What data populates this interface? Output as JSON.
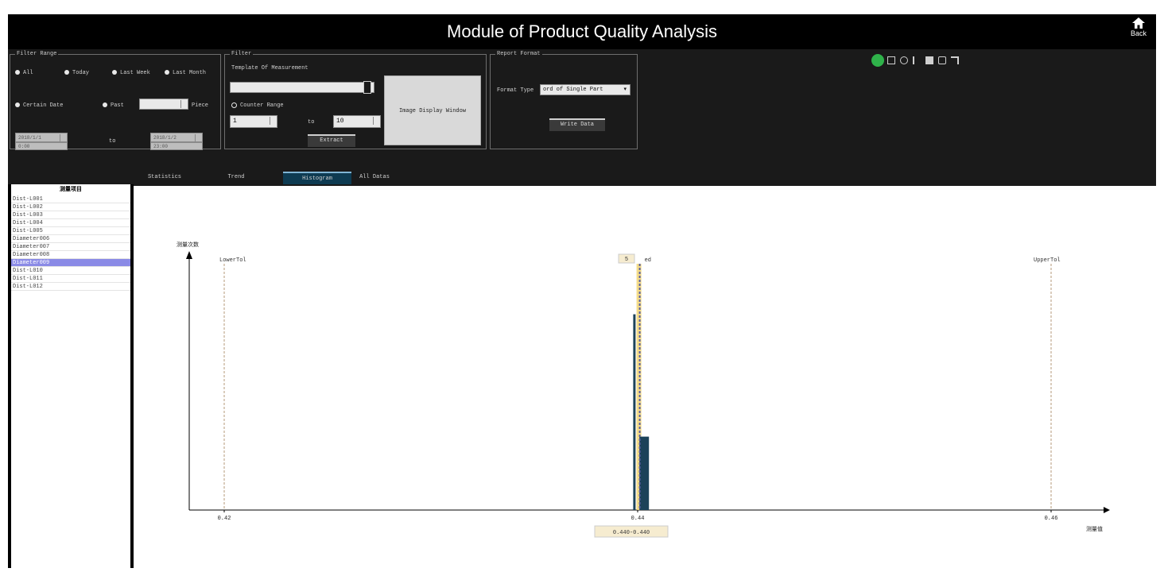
{
  "window": {
    "title": "Module of Product Quality Analysis",
    "back_label": "Back"
  },
  "filter_range": {
    "legend": "Filter Range",
    "options": [
      "All",
      "Today",
      "Last Week",
      "Last Month"
    ],
    "certain_date_label": "Certain Date",
    "past_label": "Past",
    "past_value": "",
    "piece_label": "Piece",
    "date_from": "2018/1/1",
    "time_from": "0:00",
    "to_label": "to",
    "date_to": "2018/1/2",
    "time_to": "23:00"
  },
  "filter": {
    "legend": "Filter",
    "template_label": "Template Of Measurement",
    "template_value": "",
    "counter_range_label": "Counter Range",
    "counter_from": "1",
    "to_label": "to",
    "counter_to": "10",
    "extract_label": "Extract",
    "image_window_label": "Image Display Window"
  },
  "report_format": {
    "legend": "Report Format",
    "format_type_label": "Format Type",
    "format_type_value": "ord of Single Part",
    "write_data_label": "Write Data"
  },
  "side_list": {
    "title": "测量项目",
    "items": [
      "Dist-L001",
      "Dist-L002",
      "Dist-L003",
      "Dist-L004",
      "Dist-L005",
      "Diameter006",
      "Diameter007",
      "Diameter008",
      "Diameter009",
      "Dist-L010",
      "Dist-L011",
      "Dist-L012"
    ],
    "selected_index": 8
  },
  "tabs": [
    "Statistics",
    "Trend",
    "Histogram",
    "All Datas"
  ],
  "active_tab": "Histogram",
  "chart_data": {
    "type": "bar",
    "y_axis_label": "测量次数",
    "x_axis_label": "测量值",
    "x_ticks": [
      "0.42",
      "0.44",
      "0.46"
    ],
    "xlim": [
      0.42,
      0.46
    ],
    "reference_lines": [
      {
        "label": "LowerTol",
        "x": 0.42
      },
      {
        "label": "UpperTol",
        "x": 0.46
      },
      {
        "label": "Mean",
        "label_text": "ed",
        "x": 0.4401
      }
    ],
    "bars": [
      {
        "x": 0.4399,
        "value": 8
      },
      {
        "x": 0.4402,
        "value": 3
      }
    ],
    "ylim": [
      0,
      10
    ],
    "cursor_value": "5",
    "hover_range": "0.440-0.440",
    "colors": {
      "bar": "#1c4259",
      "tolerance": "#b59a7a",
      "mean": "#5a5fa0",
      "cursor": "#f2d675"
    }
  }
}
